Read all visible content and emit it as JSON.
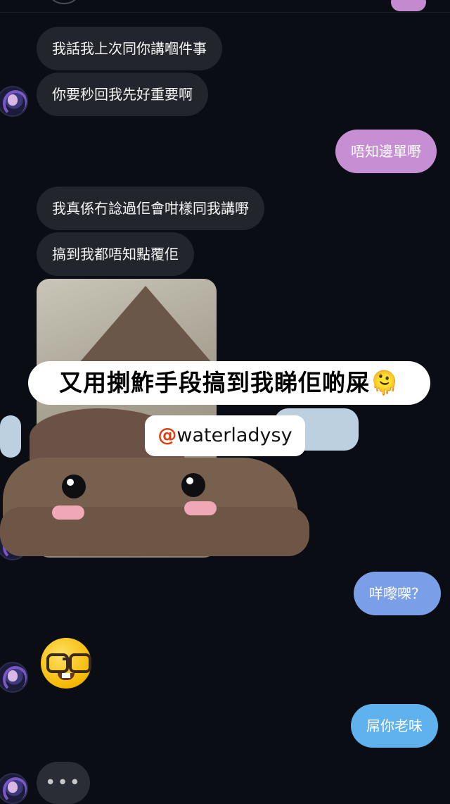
{
  "messages": [
    {
      "text": "我話我上次同你講嗰件事"
    },
    {
      "text": "你要秒回我先好重要啊"
    },
    {
      "text": "唔知邊單嘢"
    },
    {
      "text": "我真係冇諗過佢會咁樣同我講嘢"
    },
    {
      "text": "搞到我都唔知點覆佢"
    },
    {
      "text": "咩嚟㗎？"
    },
    {
      "text": "屌你老味"
    }
  ],
  "overlay": {
    "caption": "又用揦鮓手段搞到我睇佢啲屎🫠",
    "handle_symbol": "@",
    "handle": "waterladysy"
  },
  "typing": {
    "dots": "•••"
  },
  "colors": {
    "background": "#0b0d14",
    "incoming_bubble": "#22252c",
    "outgoing_pink": "#c78fd3",
    "outgoing_blue": "#7b9ee8",
    "outgoing_sky": "#5fb2ee"
  },
  "icons": {
    "avatar": "avatar-icon",
    "nerd_emoji": "nerd-face-emoji-icon",
    "typing": "typing-indicator-icon"
  }
}
